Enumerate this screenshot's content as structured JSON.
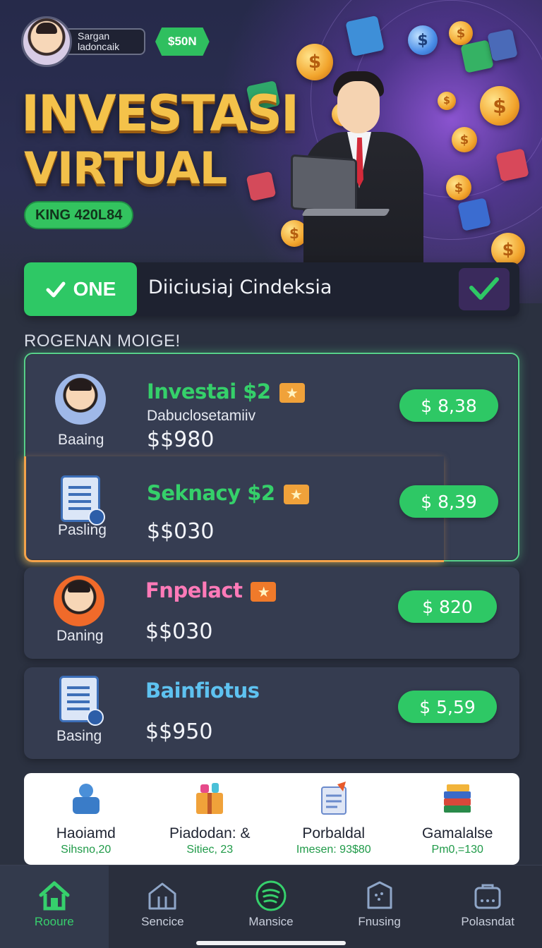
{
  "profile": {
    "name_line1": "Sargan",
    "name_line2": "ladoncaik",
    "balance_badge": "$50N"
  },
  "hero": {
    "title_line1": "INVESTASI",
    "title_line2": "VIRTUAL",
    "code": "KING 420L84"
  },
  "status_bar": {
    "tab_label": "ONE",
    "tab_icon": "check-icon",
    "text": "Diiciusiaj Cindeksia",
    "confirm_icon": "check-icon"
  },
  "section_title": "ROGENAN MOIGE!",
  "items": [
    {
      "icon": "investor-avatar-icon",
      "caption": "Baaing",
      "title": "Investai $2",
      "subtitle": "Dabuclosetamiiv",
      "amount": "$$980",
      "price": "$ 8,38",
      "title_color": "#35d06a"
    },
    {
      "icon": "document-icon",
      "caption": "Pasling",
      "title": "Seknacy $2",
      "subtitle": "",
      "amount": "$$030",
      "price": "$ 8,39",
      "title_color": "#35d06a"
    },
    {
      "icon": "investor-avatar-icon",
      "caption": "Daning",
      "title": "Fnpelact",
      "subtitle": "",
      "amount": "$$030",
      "price": "$ 820",
      "title_color": "#ff7ab8"
    },
    {
      "icon": "document-icon",
      "caption": "Basing",
      "title": "Bainfiotus",
      "subtitle": "",
      "amount": "$$950",
      "price": "$ 5,59",
      "title_color": "#5ec2f0"
    }
  ],
  "stats": [
    {
      "icon": "blue-figure-icon",
      "label": "Haoiamd",
      "value": "Sihsno,20"
    },
    {
      "icon": "gift-box-icon",
      "label": "Piadodan: &",
      "value": "Sitiec, 23"
    },
    {
      "icon": "report-icon",
      "label": "Porbaldal",
      "value": "Imesen: 93$80"
    },
    {
      "icon": "stack-books-icon",
      "label": "Gamalalse",
      "value": "Pm0,=130"
    }
  ],
  "nav": [
    {
      "icon": "home-icon",
      "label": "Rooure",
      "active": true
    },
    {
      "icon": "building-icon",
      "label": "Sencice",
      "active": false
    },
    {
      "icon": "spotify-like-icon",
      "label": "Mansice",
      "active": false
    },
    {
      "icon": "store-icon",
      "label": "Fnusing",
      "active": false
    },
    {
      "icon": "shop-icon",
      "label": "Polasndat",
      "active": false
    }
  ]
}
